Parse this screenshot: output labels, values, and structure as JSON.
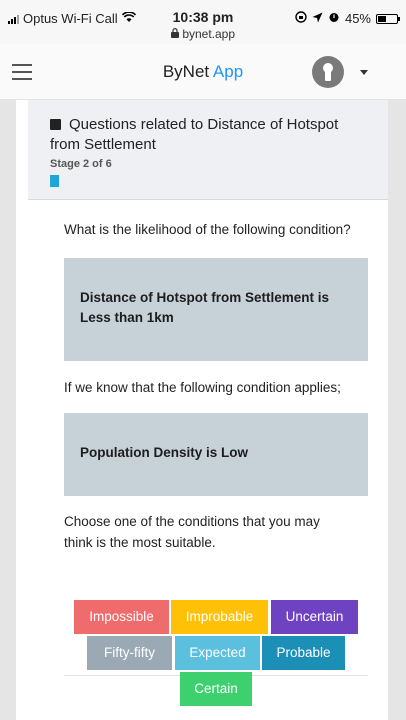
{
  "status_bar": {
    "carrier": "Optus Wi-Fi Call",
    "time": "10:38 pm",
    "url": "bynet.app",
    "battery": "45%",
    "battery_level": 0.45
  },
  "header": {
    "brand_main": "ByNet",
    "brand_accent": "App",
    "accent_color": "#2196f3"
  },
  "stage": {
    "title": "Questions related to Distance of Hotspot from Settlement",
    "stage_label": "Stage 2 of 6",
    "progress": 0.33
  },
  "question": {
    "prompt": "What is the likelihood of the following condition?",
    "condition_line1": "Distance of Hotspot from Settlement is",
    "condition_line2": "Less than 1km",
    "given_text": "If we know that the following condition applies;",
    "given_condition": "Population Density is Low",
    "instruction_line1": "Choose one of the conditions that you may",
    "instruction_line2": "think is the most suitable."
  },
  "options": [
    {
      "label": "Impossible",
      "color": "#f06b6b"
    },
    {
      "label": "Improbable",
      "color": "#ffc107"
    },
    {
      "label": "Uncertain",
      "color": "#6f42c1"
    },
    {
      "label": "Fifty-fifty",
      "color": "#9aa9b4"
    },
    {
      "label": "Expected",
      "color": "#5bc0de"
    },
    {
      "label": "Probable",
      "color": "#1b8fb5"
    },
    {
      "label": "Certain",
      "color": "#3ecf6f"
    }
  ]
}
